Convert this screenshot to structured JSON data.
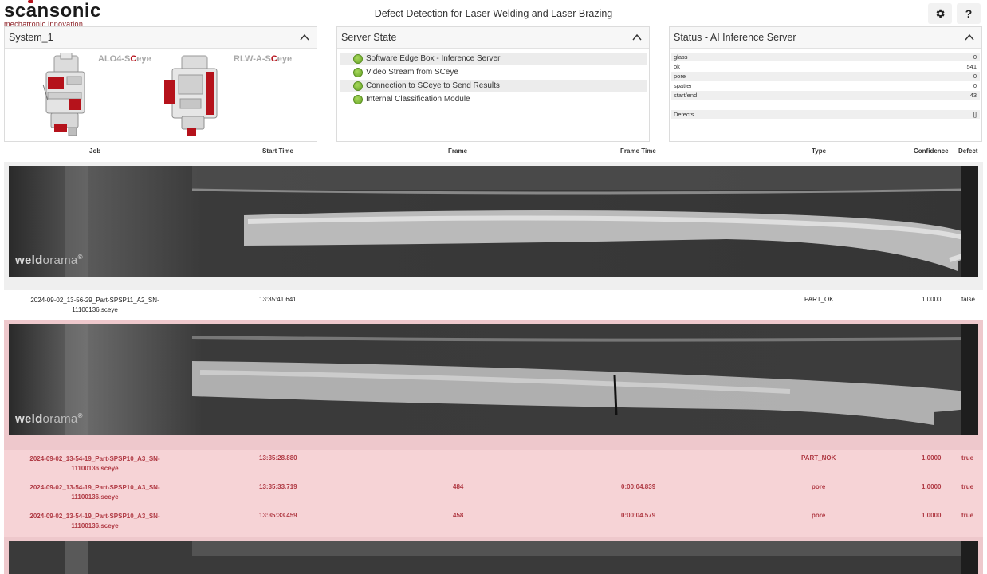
{
  "header": {
    "logo_main": "scansonic",
    "logo_sub": "mechatronic innovation",
    "title": "Defect Detection for Laser Welding and Laser Brazing",
    "settings_icon": "gear-icon",
    "help_label": "?"
  },
  "system_panel": {
    "title": "System_1",
    "systems": [
      {
        "prefix": "ALO4-S",
        "accent": "C",
        "suffix": "eye"
      },
      {
        "prefix": "RLW-A-S",
        "accent": "C",
        "suffix": "eye"
      }
    ]
  },
  "server_panel": {
    "title": "Server State",
    "items": [
      {
        "label": "Software Edge Box - Inference Server",
        "status": "green"
      },
      {
        "label": "Video Stream from SCeye",
        "status": "green"
      },
      {
        "label": "Connection to SCeye to Send Results",
        "status": "green"
      },
      {
        "label": "Internal Classification Module",
        "status": "green"
      }
    ]
  },
  "status_panel": {
    "title": "Status - AI Inference Server",
    "counts": [
      {
        "key": "glass",
        "value": "0"
      },
      {
        "key": "ok",
        "value": "541"
      },
      {
        "key": "pore",
        "value": "0"
      },
      {
        "key": "spatter",
        "value": "0"
      },
      {
        "key": "start/end",
        "value": "43"
      }
    ],
    "defects": {
      "key": "Defects",
      "value": "[]"
    }
  },
  "columns": {
    "job": "Job",
    "start_time": "Start Time",
    "frame": "Frame",
    "frame_time": "Frame Time",
    "type": "Type",
    "confidence": "Confidence",
    "defect": "Defect"
  },
  "image_logo": {
    "bold": "weld",
    "thin": "orama",
    "mark": "®"
  },
  "results": [
    {
      "status": "ok",
      "rows": [
        {
          "job_line1": "2024-09-02_13-56-29_Part-SPSP11_A2_SN-",
          "job_line2": "11100136.sceye",
          "start_time": "13:35:41.641",
          "frame": "",
          "frame_time": "",
          "type": "PART_OK",
          "confidence": "1.0000",
          "defect": "false"
        }
      ]
    },
    {
      "status": "nok",
      "rows": [
        {
          "job_line1": "2024-09-02_13-54-19_Part-SPSP10_A3_SN-",
          "job_line2": "11100136.sceye",
          "start_time": "13:35:28.880",
          "frame": "",
          "frame_time": "",
          "type": "PART_NOK",
          "confidence": "1.0000",
          "defect": "true"
        },
        {
          "job_line1": "2024-09-02_13-54-19_Part-SPSP10_A3_SN-",
          "job_line2": "11100136.sceye",
          "start_time": "13:35:33.719",
          "frame": "484",
          "frame_time": "0:00:04.839",
          "type": "pore",
          "confidence": "1.0000",
          "defect": "true"
        },
        {
          "job_line1": "2024-09-02_13-54-19_Part-SPSP10_A3_SN-",
          "job_line2": "11100136.sceye",
          "start_time": "13:35:33.459",
          "frame": "458",
          "frame_time": "0:00:04.579",
          "type": "pore",
          "confidence": "1.0000",
          "defect": "true"
        }
      ]
    }
  ],
  "colors": {
    "accent": "#b5121b",
    "ok_green": "#7bbf3a",
    "nok_row": "#f6d3d6",
    "nok_text": "#b03a44"
  }
}
